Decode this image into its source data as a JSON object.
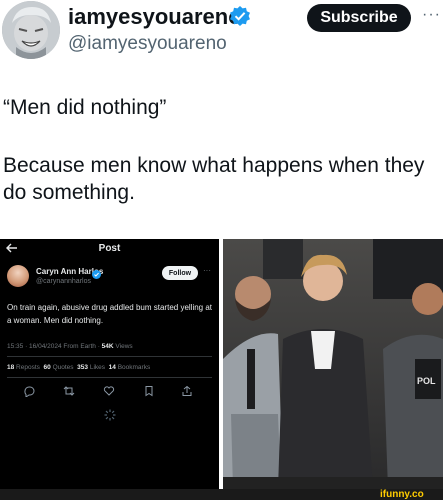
{
  "header": {
    "display_name": "iamyesyouareno",
    "handle": "@iamyesyouareno",
    "subscribe_label": "Subscribe",
    "more_label": "···"
  },
  "post": {
    "quote_line": "“Men did nothing”",
    "body": "Because men know what happens when they do something."
  },
  "embedded": {
    "back_icon": "arrow-left-icon",
    "title": "Post",
    "author_name": "Caryn Ann Harlos",
    "author_handle": "@carynannharlos",
    "follow_label": "Follow",
    "more_label": "···",
    "text": "On train again, abusive drug addled bum started yelling at a woman. Men did nothing.",
    "time": "15:35 · 16/04/2024 From Earth ·",
    "views_count": "54K",
    "views_label": "Views",
    "reposts_count": "18",
    "reposts_label": "Reposts",
    "quotes_count": "60",
    "quotes_label": "Quotes",
    "likes_count": "353",
    "likes_label": "Likes",
    "bookmarks_count": "14",
    "bookmarks_label": "Bookmarks"
  },
  "footer": {
    "watermark": "ifunny.co"
  },
  "colors": {
    "verified_blue": "#1d9bf0",
    "text_dark": "#0f1419",
    "text_gray": "#536471"
  }
}
